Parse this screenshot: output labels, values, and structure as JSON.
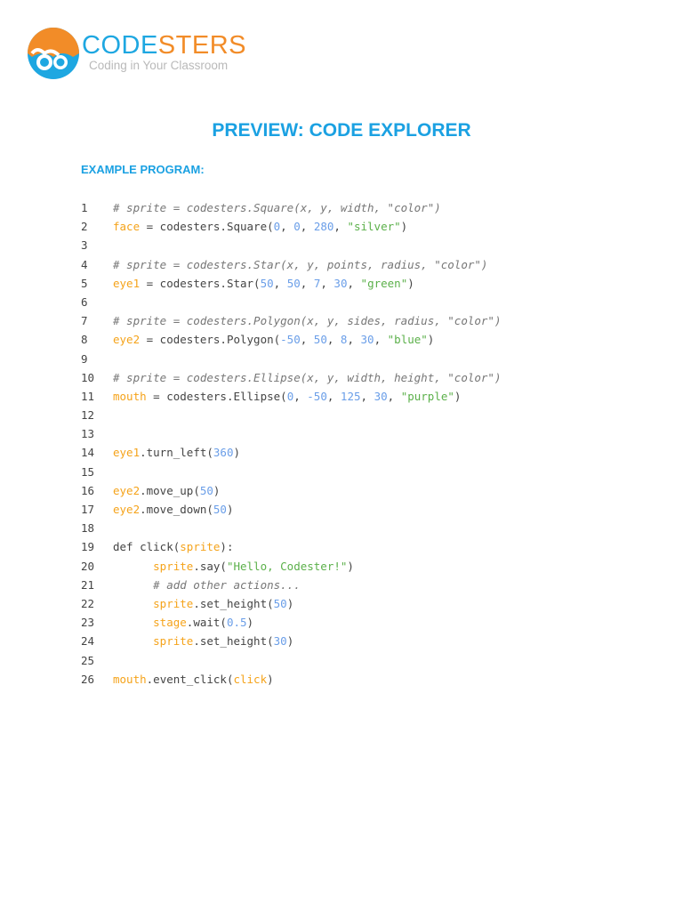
{
  "logo": {
    "name_a": "CODE",
    "name_b": "STERS",
    "tagline": "Coding in Your Classroom"
  },
  "title": "PREVIEW: CODE EXPLORER",
  "subtitle": "EXAMPLE PROGRAM:",
  "colors": {
    "accent": "#1ba1e2",
    "orange": "#f28c28",
    "variable": "#f5a31a",
    "number": "#6a9ee8",
    "string": "#5bb04a",
    "comment": "#777777"
  },
  "code_lines": [
    {
      "n": "1",
      "tokens": [
        [
          "# sprite = codesters.Square(x, y, width, \"color\")",
          "c"
        ]
      ]
    },
    {
      "n": "2",
      "tokens": [
        [
          "face",
          "v"
        ],
        [
          " = codesters.Square(",
          "p"
        ],
        [
          "0",
          "n"
        ],
        [
          ", ",
          "p"
        ],
        [
          "0",
          "n"
        ],
        [
          ", ",
          "p"
        ],
        [
          "280",
          "n"
        ],
        [
          ", ",
          "p"
        ],
        [
          "\"silver\"",
          "s"
        ],
        [
          ")",
          "p"
        ]
      ]
    },
    {
      "n": "3",
      "tokens": []
    },
    {
      "n": "4",
      "tokens": [
        [
          "# sprite = codesters.Star(x, y, points, radius, \"color\")",
          "c"
        ]
      ]
    },
    {
      "n": "5",
      "tokens": [
        [
          "eye1",
          "v"
        ],
        [
          " = codesters.Star(",
          "p"
        ],
        [
          "50",
          "n"
        ],
        [
          ", ",
          "p"
        ],
        [
          "50",
          "n"
        ],
        [
          ", ",
          "p"
        ],
        [
          "7",
          "n"
        ],
        [
          ", ",
          "p"
        ],
        [
          "30",
          "n"
        ],
        [
          ", ",
          "p"
        ],
        [
          "\"green\"",
          "s"
        ],
        [
          ")",
          "p"
        ]
      ]
    },
    {
      "n": "6",
      "tokens": []
    },
    {
      "n": "7",
      "tokens": [
        [
          "# sprite = codesters.Polygon(x, y, sides, radius, \"color\")",
          "c"
        ]
      ]
    },
    {
      "n": "8",
      "tokens": [
        [
          "eye2",
          "v"
        ],
        [
          " = codesters.Polygon(",
          "p"
        ],
        [
          "-50",
          "n"
        ],
        [
          ", ",
          "p"
        ],
        [
          "50",
          "n"
        ],
        [
          ", ",
          "p"
        ],
        [
          "8",
          "n"
        ],
        [
          ", ",
          "p"
        ],
        [
          "30",
          "n"
        ],
        [
          ", ",
          "p"
        ],
        [
          "\"blue\"",
          "s"
        ],
        [
          ")",
          "p"
        ]
      ]
    },
    {
      "n": "9",
      "tokens": []
    },
    {
      "n": "10",
      "tokens": [
        [
          "# sprite = codesters.Ellipse(x, y, width, height, \"color\")",
          "c"
        ]
      ]
    },
    {
      "n": "11",
      "tokens": [
        [
          "mouth",
          "v"
        ],
        [
          " = codesters.Ellipse(",
          "p"
        ],
        [
          "0",
          "n"
        ],
        [
          ", ",
          "p"
        ],
        [
          "-50",
          "n"
        ],
        [
          ", ",
          "p"
        ],
        [
          "125",
          "n"
        ],
        [
          ", ",
          "p"
        ],
        [
          "30",
          "n"
        ],
        [
          ", ",
          "p"
        ],
        [
          "\"purple\"",
          "s"
        ],
        [
          ")",
          "p"
        ]
      ]
    },
    {
      "n": "12",
      "tokens": []
    },
    {
      "n": "13",
      "tokens": []
    },
    {
      "n": "14",
      "tokens": [
        [
          "eye1",
          "v"
        ],
        [
          ".turn_left(",
          "p"
        ],
        [
          "360",
          "n"
        ],
        [
          ")",
          "p"
        ]
      ]
    },
    {
      "n": "15",
      "tokens": []
    },
    {
      "n": "16",
      "tokens": [
        [
          "eye2",
          "v"
        ],
        [
          ".move_up(",
          "p"
        ],
        [
          "50",
          "n"
        ],
        [
          ")",
          "p"
        ]
      ]
    },
    {
      "n": "17",
      "tokens": [
        [
          "eye2",
          "v"
        ],
        [
          ".move_down(",
          "p"
        ],
        [
          "50",
          "n"
        ],
        [
          ")",
          "p"
        ]
      ]
    },
    {
      "n": "18",
      "tokens": []
    },
    {
      "n": "19",
      "tokens": [
        [
          "def click(",
          "p"
        ],
        [
          "sprite",
          "v"
        ],
        [
          "):",
          "p"
        ]
      ]
    },
    {
      "n": "20",
      "tokens": [
        [
          "      ",
          "p"
        ],
        [
          "sprite",
          "v"
        ],
        [
          ".say(",
          "p"
        ],
        [
          "\"Hello, Codester!\"",
          "s"
        ],
        [
          ")",
          "p"
        ]
      ]
    },
    {
      "n": "21",
      "tokens": [
        [
          "      ",
          "p"
        ],
        [
          "# add other actions...",
          "c"
        ]
      ]
    },
    {
      "n": "22",
      "tokens": [
        [
          "      ",
          "p"
        ],
        [
          "sprite",
          "v"
        ],
        [
          ".set_height(",
          "p"
        ],
        [
          "50",
          "n"
        ],
        [
          ")",
          "p"
        ]
      ]
    },
    {
      "n": "23",
      "tokens": [
        [
          "      ",
          "p"
        ],
        [
          "stage",
          "v"
        ],
        [
          ".wait(",
          "p"
        ],
        [
          "0.5",
          "n"
        ],
        [
          ")",
          "p"
        ]
      ]
    },
    {
      "n": "24",
      "tokens": [
        [
          "      ",
          "p"
        ],
        [
          "sprite",
          "v"
        ],
        [
          ".set_height(",
          "p"
        ],
        [
          "30",
          "n"
        ],
        [
          ")",
          "p"
        ]
      ]
    },
    {
      "n": "25",
      "tokens": []
    },
    {
      "n": "26",
      "tokens": [
        [
          "mouth",
          "v"
        ],
        [
          ".event_click(",
          "p"
        ],
        [
          "click",
          "v"
        ],
        [
          ")",
          "p"
        ]
      ]
    }
  ]
}
